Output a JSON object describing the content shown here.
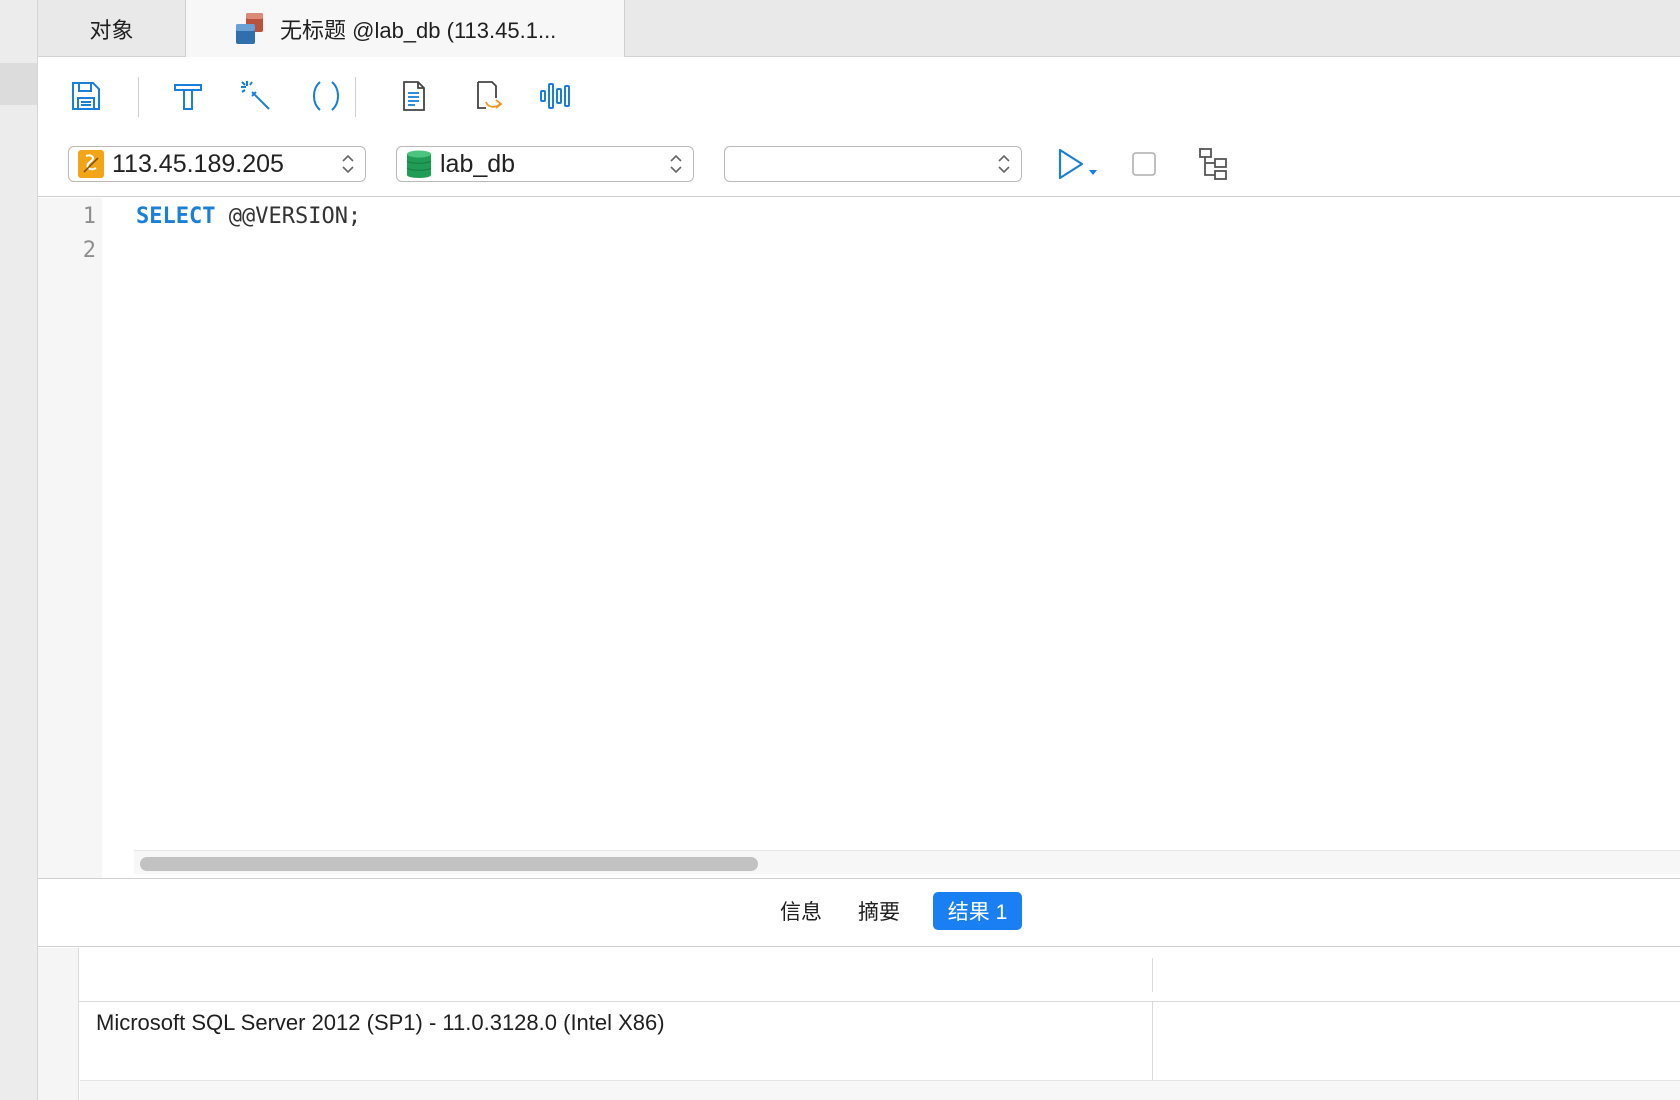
{
  "tabs": {
    "objects": "对象",
    "query": "无标题 @lab_db (113.45.1..."
  },
  "toolbar": {
    "save": "save-icon",
    "format": "format-icon",
    "beautify": "magic-wand-icon",
    "parentheses": "parentheses-icon",
    "text": "document-icon",
    "export": "export-icon",
    "explain": "waveform-icon"
  },
  "connection": {
    "value": "113.45.189.205"
  },
  "database": {
    "value": "lab_db"
  },
  "schema": {
    "value": ""
  },
  "editor": {
    "lines": [
      "1",
      "2"
    ],
    "keyword": "SELECT",
    "rest": " @@VERSION;"
  },
  "results": {
    "tabs": [
      "信息",
      "摘要",
      "结果 1"
    ],
    "active_tab": "结果 1",
    "columns": [
      ""
    ],
    "rows": [
      [
        "Microsoft SQL Server 2012 (SP1) - 11.0.3128.0 (Intel X86)"
      ]
    ]
  },
  "colors": {
    "accent": "#1a7ff2",
    "keyword": "#1a7fd9"
  }
}
